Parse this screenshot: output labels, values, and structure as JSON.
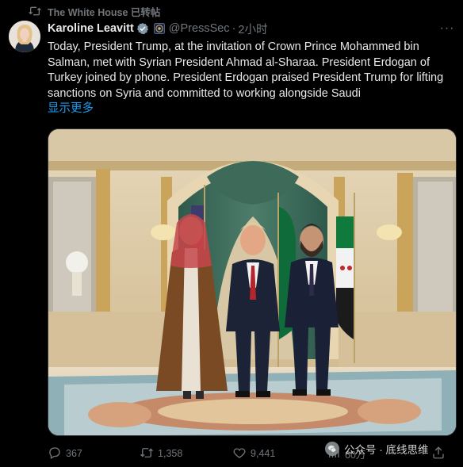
{
  "retweet": {
    "icon": "retweet-icon",
    "text": "The White House 已转帖"
  },
  "author": {
    "name": "Karoline Leavitt",
    "handle": "@PressSec",
    "separator": "·",
    "time": "2小时",
    "verified_color": "#829aab"
  },
  "more_label": "···",
  "tweet": {
    "text": "Today, President Trump, at the invitation of Crown Prince Mohammed bin Salman, met with Syrian President Ahmad al-Sharaa. President Erdogan of Turkey joined by phone. President Erdogan praised President Trump for lifting sanctions on Syria and committed to working alongside Saudi",
    "show_more": "显示更多"
  },
  "media": {
    "icon": "meeting-photo"
  },
  "actions": {
    "replies": "367",
    "reposts": "1,358",
    "likes": "9,441",
    "views": "60万"
  },
  "watermark": {
    "text": "公众号 · 底线思维"
  },
  "colors": {
    "background": "#000000",
    "text": "#e7e9ea",
    "muted": "#71767b",
    "link": "#1d9bf0"
  }
}
